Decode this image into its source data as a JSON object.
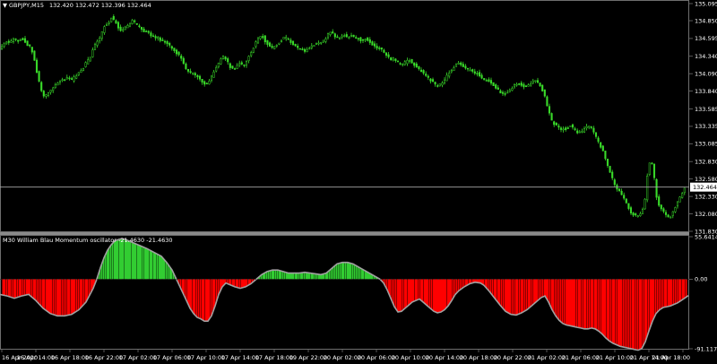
{
  "chart_data": [
    {
      "type": "candlestick",
      "title": "GBPJPY,M15",
      "ohlc_text": "132.420 132.472 132.396 132.464",
      "current_price_label": "132.464",
      "current_price": 132.464,
      "ylim": [
        131.83,
        135.095
      ],
      "price_ticks": [
        "135.095",
        "134.850",
        "134.595",
        "134.340",
        "134.090",
        "133.840",
        "133.585",
        "133.335",
        "133.085",
        "132.830",
        "132.580",
        "132.330",
        "132.080",
        "131.830"
      ],
      "price_path": [
        [
          0,
          134.45
        ],
        [
          4,
          134.5
        ],
        [
          8,
          134.55
        ],
        [
          12,
          134.55
        ],
        [
          16,
          134.6
        ],
        [
          20,
          134.55
        ],
        [
          24,
          134.6
        ],
        [
          28,
          134.55
        ],
        [
          31,
          134.5
        ],
        [
          35,
          134.45
        ],
        [
          38,
          134.3
        ],
        [
          42,
          134.05
        ],
        [
          45,
          133.9
        ],
        [
          48,
          133.75
        ],
        [
          52,
          133.8
        ],
        [
          56,
          133.85
        ],
        [
          60,
          133.9
        ],
        [
          64,
          133.95
        ],
        [
          68,
          134.0
        ],
        [
          72,
          134.0
        ],
        [
          76,
          134.05
        ],
        [
          80,
          134.0
        ],
        [
          84,
          134.05
        ],
        [
          88,
          134.1
        ],
        [
          92,
          134.15
        ],
        [
          96,
          134.25
        ],
        [
          100,
          134.3
        ],
        [
          104,
          134.45
        ],
        [
          108,
          134.55
        ],
        [
          112,
          134.6
        ],
        [
          115,
          134.75
        ],
        [
          118,
          134.8
        ],
        [
          121,
          134.8
        ],
        [
          124,
          134.9
        ],
        [
          128,
          134.85
        ],
        [
          132,
          134.75
        ],
        [
          136,
          134.7
        ],
        [
          140,
          134.75
        ],
        [
          144,
          134.8
        ],
        [
          148,
          134.85
        ],
        [
          152,
          134.8
        ],
        [
          156,
          134.75
        ],
        [
          160,
          134.7
        ],
        [
          164,
          134.7
        ],
        [
          168,
          134.65
        ],
        [
          172,
          134.6
        ],
        [
          176,
          134.6
        ],
        [
          180,
          134.55
        ],
        [
          184,
          134.55
        ],
        [
          188,
          134.5
        ],
        [
          192,
          134.45
        ],
        [
          196,
          134.4
        ],
        [
          200,
          134.35
        ],
        [
          204,
          134.25
        ],
        [
          208,
          134.15
        ],
        [
          212,
          134.1
        ],
        [
          216,
          134.1
        ],
        [
          220,
          134.05
        ],
        [
          224,
          134.0
        ],
        [
          228,
          133.95
        ],
        [
          232,
          133.95
        ],
        [
          236,
          134.05
        ],
        [
          240,
          134.15
        ],
        [
          244,
          134.25
        ],
        [
          248,
          134.35
        ],
        [
          252,
          134.3
        ],
        [
          256,
          134.2
        ],
        [
          260,
          134.15
        ],
        [
          264,
          134.2
        ],
        [
          268,
          134.25
        ],
        [
          272,
          134.2
        ],
        [
          276,
          134.3
        ],
        [
          280,
          134.4
        ],
        [
          284,
          134.5
        ],
        [
          288,
          134.6
        ],
        [
          292,
          134.65
        ],
        [
          296,
          134.55
        ],
        [
          300,
          134.5
        ],
        [
          304,
          134.45
        ],
        [
          308,
          134.5
        ],
        [
          312,
          134.55
        ],
        [
          316,
          134.6
        ],
        [
          320,
          134.6
        ],
        [
          324,
          134.55
        ],
        [
          328,
          134.5
        ],
        [
          332,
          134.45
        ],
        [
          336,
          134.45
        ],
        [
          340,
          134.4
        ],
        [
          344,
          134.45
        ],
        [
          348,
          134.5
        ],
        [
          352,
          134.5
        ],
        [
          356,
          134.55
        ],
        [
          360,
          134.55
        ],
        [
          364,
          134.6
        ],
        [
          368,
          134.7
        ],
        [
          372,
          134.65
        ],
        [
          376,
          134.6
        ],
        [
          380,
          134.6
        ],
        [
          384,
          134.65
        ],
        [
          388,
          134.6
        ],
        [
          392,
          134.65
        ],
        [
          396,
          134.6
        ],
        [
          400,
          134.6
        ],
        [
          404,
          134.55
        ],
        [
          408,
          134.6
        ],
        [
          412,
          134.55
        ],
        [
          416,
          134.5
        ],
        [
          420,
          134.45
        ],
        [
          424,
          134.45
        ],
        [
          428,
          134.4
        ],
        [
          432,
          134.35
        ],
        [
          436,
          134.3
        ],
        [
          440,
          134.3
        ],
        [
          444,
          134.25
        ],
        [
          448,
          134.2
        ],
        [
          452,
          134.25
        ],
        [
          456,
          134.3
        ],
        [
          460,
          134.25
        ],
        [
          464,
          134.2
        ],
        [
          468,
          134.15
        ],
        [
          472,
          134.1
        ],
        [
          476,
          134.05
        ],
        [
          480,
          134.0
        ],
        [
          484,
          133.95
        ],
        [
          488,
          133.9
        ],
        [
          492,
          133.95
        ],
        [
          496,
          134.0
        ],
        [
          500,
          134.1
        ],
        [
          504,
          134.15
        ],
        [
          508,
          134.2
        ],
        [
          512,
          134.25
        ],
        [
          516,
          134.2
        ],
        [
          520,
          134.15
        ],
        [
          524,
          134.15
        ],
        [
          528,
          134.1
        ],
        [
          532,
          134.1
        ],
        [
          536,
          134.05
        ],
        [
          540,
          134.0
        ],
        [
          544,
          134.0
        ],
        [
          548,
          133.95
        ],
        [
          552,
          133.9
        ],
        [
          556,
          133.85
        ],
        [
          560,
          133.8
        ],
        [
          564,
          133.8
        ],
        [
          568,
          133.85
        ],
        [
          572,
          133.9
        ],
        [
          576,
          133.95
        ],
        [
          580,
          133.95
        ],
        [
          584,
          133.9
        ],
        [
          588,
          133.9
        ],
        [
          592,
          133.95
        ],
        [
          596,
          134.0
        ],
        [
          600,
          133.95
        ],
        [
          604,
          133.9
        ],
        [
          608,
          133.75
        ],
        [
          612,
          133.55
        ],
        [
          616,
          133.4
        ],
        [
          620,
          133.35
        ],
        [
          624,
          133.3
        ],
        [
          628,
          133.3
        ],
        [
          632,
          133.3
        ],
        [
          636,
          133.35
        ],
        [
          640,
          133.3
        ],
        [
          644,
          133.25
        ],
        [
          648,
          133.25
        ],
        [
          652,
          133.3
        ],
        [
          656,
          133.35
        ],
        [
          660,
          133.3
        ],
        [
          664,
          133.2
        ],
        [
          668,
          133.1
        ],
        [
          672,
          133.0
        ],
        [
          676,
          132.85
        ],
        [
          680,
          132.7
        ],
        [
          684,
          132.55
        ],
        [
          688,
          132.45
        ],
        [
          692,
          132.4
        ],
        [
          696,
          132.3
        ],
        [
          700,
          132.2
        ],
        [
          704,
          132.1
        ],
        [
          708,
          132.05
        ],
        [
          712,
          132.05
        ],
        [
          716,
          132.1
        ],
        [
          720,
          132.3
        ],
        [
          723,
          132.75
        ],
        [
          726,
          132.85
        ],
        [
          729,
          132.7
        ],
        [
          732,
          132.35
        ],
        [
          735,
          132.2
        ],
        [
          738,
          132.15
        ],
        [
          741,
          132.1
        ],
        [
          744,
          132.05
        ],
        [
          747,
          132.0
        ],
        [
          750,
          132.1
        ],
        [
          754,
          132.2
        ],
        [
          758,
          132.3
        ],
        [
          762,
          132.4
        ],
        [
          765,
          132.46
        ]
      ],
      "x_tick_labels": [
        "16 Apr 2020",
        "16 Apr 14:00",
        "16 Apr 18:00",
        "16 Apr 22:00",
        "17 Apr 02:00",
        "17 Apr 06:00",
        "17 Apr 10:00",
        "17 Apr 14:00",
        "17 Apr 18:00",
        "19 Apr 22:00",
        "20 Apr 02:00",
        "20 Apr 06:00",
        "20 Apr 10:00",
        "20 Apr 14:00",
        "20 Apr 18:00",
        "20 Apr 22:00",
        "21 Apr 02:00",
        "21 Apr 06:00",
        "21 Apr 10:00",
        "21 Apr 14:00",
        "21 Apr 18:00"
      ]
    },
    {
      "type": "area",
      "title": "M30 William Blau Momentum oscillator -21.4630 -21.4630",
      "ylim": [
        -91.1176,
        55.6414
      ],
      "y_ticks": [
        "55.6414",
        "0.00",
        "-91.1176"
      ],
      "colors": {
        "positive": "#32cd32",
        "negative": "#ff0000",
        "line": "#a0a0a0"
      },
      "momentum_path": [
        [
          0,
          -20
        ],
        [
          8,
          -22
        ],
        [
          16,
          -25
        ],
        [
          24,
          -22
        ],
        [
          32,
          -20
        ],
        [
          40,
          -28
        ],
        [
          48,
          -38
        ],
        [
          56,
          -45
        ],
        [
          64,
          -48
        ],
        [
          72,
          -48
        ],
        [
          80,
          -46
        ],
        [
          88,
          -40
        ],
        [
          96,
          -30
        ],
        [
          104,
          -12
        ],
        [
          108,
          0
        ],
        [
          112,
          15
        ],
        [
          116,
          28
        ],
        [
          120,
          38
        ],
        [
          124,
          45
        ],
        [
          128,
          50
        ],
        [
          132,
          52
        ],
        [
          136,
          53
        ],
        [
          140,
          52
        ],
        [
          148,
          48
        ],
        [
          156,
          44
        ],
        [
          164,
          40
        ],
        [
          172,
          35
        ],
        [
          180,
          30
        ],
        [
          186,
          22
        ],
        [
          192,
          12
        ],
        [
          196,
          2
        ],
        [
          200,
          -8
        ],
        [
          204,
          -18
        ],
        [
          208,
          -28
        ],
        [
          212,
          -38
        ],
        [
          216,
          -45
        ],
        [
          220,
          -50
        ],
        [
          224,
          -52
        ],
        [
          228,
          -55
        ],
        [
          232,
          -55
        ],
        [
          236,
          -48
        ],
        [
          240,
          -35
        ],
        [
          244,
          -20
        ],
        [
          248,
          -10
        ],
        [
          252,
          -5
        ],
        [
          256,
          -7
        ],
        [
          262,
          -10
        ],
        [
          268,
          -12
        ],
        [
          274,
          -10
        ],
        [
          280,
          -6
        ],
        [
          286,
          0
        ],
        [
          292,
          6
        ],
        [
          298,
          10
        ],
        [
          304,
          12
        ],
        [
          310,
          12
        ],
        [
          316,
          10
        ],
        [
          322,
          8
        ],
        [
          328,
          8
        ],
        [
          334,
          8
        ],
        [
          340,
          9
        ],
        [
          346,
          8
        ],
        [
          352,
          7
        ],
        [
          358,
          6
        ],
        [
          364,
          8
        ],
        [
          370,
          14
        ],
        [
          376,
          20
        ],
        [
          382,
          22
        ],
        [
          388,
          22
        ],
        [
          394,
          20
        ],
        [
          400,
          16
        ],
        [
          406,
          12
        ],
        [
          412,
          8
        ],
        [
          418,
          4
        ],
        [
          424,
          0
        ],
        [
          428,
          -5
        ],
        [
          432,
          -14
        ],
        [
          436,
          -25
        ],
        [
          440,
          -36
        ],
        [
          444,
          -43
        ],
        [
          448,
          -42
        ],
        [
          452,
          -38
        ],
        [
          456,
          -34
        ],
        [
          460,
          -30
        ],
        [
          464,
          -28
        ],
        [
          468,
          -26
        ],
        [
          472,
          -30
        ],
        [
          476,
          -34
        ],
        [
          480,
          -38
        ],
        [
          484,
          -42
        ],
        [
          488,
          -44
        ],
        [
          492,
          -43
        ],
        [
          496,
          -40
        ],
        [
          500,
          -35
        ],
        [
          504,
          -28
        ],
        [
          508,
          -20
        ],
        [
          512,
          -15
        ],
        [
          518,
          -10
        ],
        [
          524,
          -6
        ],
        [
          530,
          -4
        ],
        [
          536,
          -5
        ],
        [
          540,
          -8
        ],
        [
          546,
          -16
        ],
        [
          552,
          -25
        ],
        [
          558,
          -34
        ],
        [
          564,
          -42
        ],
        [
          570,
          -46
        ],
        [
          576,
          -47
        ],
        [
          582,
          -44
        ],
        [
          588,
          -40
        ],
        [
          594,
          -34
        ],
        [
          600,
          -28
        ],
        [
          604,
          -24
        ],
        [
          608,
          -22
        ],
        [
          612,
          -30
        ],
        [
          616,
          -40
        ],
        [
          620,
          -48
        ],
        [
          624,
          -54
        ],
        [
          628,
          -58
        ],
        [
          632,
          -60
        ],
        [
          636,
          -61
        ],
        [
          640,
          -62
        ],
        [
          644,
          -63
        ],
        [
          648,
          -64
        ],
        [
          652,
          -65
        ],
        [
          656,
          -65
        ],
        [
          660,
          -64
        ],
        [
          664,
          -65
        ],
        [
          668,
          -68
        ],
        [
          672,
          -72
        ],
        [
          676,
          -77
        ],
        [
          680,
          -81
        ],
        [
          684,
          -84
        ],
        [
          688,
          -86
        ],
        [
          692,
          -88
        ],
        [
          696,
          -89
        ],
        [
          700,
          -90
        ],
        [
          704,
          -91
        ],
        [
          708,
          -92
        ],
        [
          712,
          -93
        ],
        [
          716,
          -91
        ],
        [
          720,
          -82
        ],
        [
          724,
          -68
        ],
        [
          728,
          -55
        ],
        [
          732,
          -45
        ],
        [
          736,
          -40
        ],
        [
          740,
          -37
        ],
        [
          744,
          -36
        ],
        [
          748,
          -35
        ],
        [
          752,
          -33
        ],
        [
          756,
          -31
        ],
        [
          760,
          -28
        ],
        [
          765,
          -24
        ],
        [
          768,
          -21.463
        ]
      ]
    }
  ]
}
